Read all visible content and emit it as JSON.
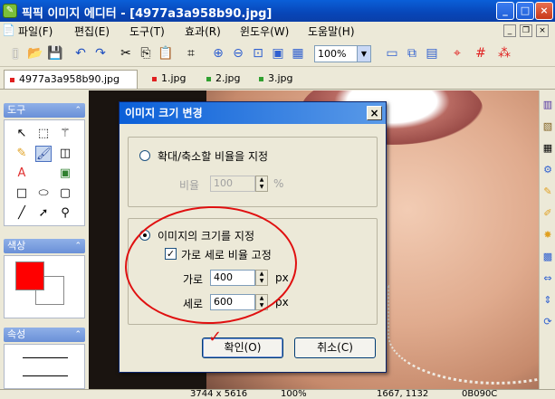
{
  "window": {
    "title": "픽픽 이미지 에디터 - [4977a3a958b90.jpg]",
    "app_icon": "picpick-app-icon",
    "controls": [
      "_",
      "□",
      "×"
    ]
  },
  "menu": [
    "파일(F)",
    "편집(E)",
    "도구(T)",
    "효과(R)",
    "윈도우(W)",
    "도움말(H)"
  ],
  "toolbar": {
    "zoom_value": "100%",
    "icons": [
      "new-icon",
      "open-icon",
      "save-icon",
      "undo-icon",
      "redo-icon",
      "cut-icon",
      "copy-icon",
      "paste-icon",
      "crop-icon",
      "zoom-in-icon",
      "zoom-out-icon",
      "fit-icon",
      "actual-size-icon",
      "grid-icon",
      "ruler-icon"
    ]
  },
  "tabs": [
    {
      "label": "4977a3a958b90.jpg",
      "color": "#e02020",
      "active": true
    },
    {
      "label": "1.jpg",
      "color": "#e02020",
      "active": false
    },
    {
      "label": "2.jpg",
      "color": "#30a030",
      "active": false
    },
    {
      "label": "3.jpg",
      "color": "#30a030",
      "active": false
    }
  ],
  "left_panel": {
    "tools_title": "도구",
    "colors_title": "색상",
    "props_title": "속성",
    "primary_color": "#ff0000",
    "secondary_color": "#ffffff"
  },
  "status": {
    "image_size": "3744 x 5616",
    "zoom": "100%",
    "cursor": "1667, 1132",
    "color": "0B090C"
  },
  "dialog": {
    "title": "이미지 크기 변경",
    "close_label": "×",
    "ratio_option": "확대/축소할 비율을 지정",
    "ratio_label": "비율",
    "ratio_value": "100",
    "ratio_unit": "%",
    "size_option": "이미지의 크기를 지정",
    "keep_ratio_label": "가로 세로 비율 고정",
    "keep_ratio_checked": true,
    "width_label": "가로",
    "width_value": "400",
    "height_label": "세로",
    "height_value": "600",
    "unit": "px",
    "ok_label": "확인(O)",
    "cancel_label": "취소(C)"
  },
  "annotations": {
    "check_mark": "✓"
  }
}
